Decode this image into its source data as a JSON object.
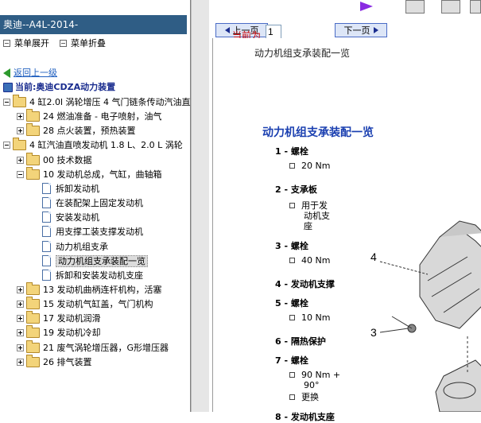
{
  "left": {
    "title": "奥迪--A4L-2014-",
    "menu_expand": "菜单展开",
    "menu_collapse": "菜单折叠",
    "back": "返回上一级",
    "current": "当前:奥迪CDZA动力装置",
    "tree": [
      {
        "label": "4 缸2.0l 涡轮增压 4 气门链条传动汽油直",
        "type": "folder",
        "expanded": true,
        "level": 0
      },
      {
        "label": "24 燃油准备 - 电子喷射，油气",
        "type": "folder",
        "expanded": false,
        "level": 1
      },
      {
        "label": "28 点火装置，预热装置",
        "type": "folder",
        "expanded": false,
        "level": 1
      },
      {
        "label": "4 缸汽油直喷发动机 1.8 L、2.0 L 涡轮",
        "type": "folder",
        "expanded": true,
        "level": 0
      },
      {
        "label": "00 技术数据",
        "type": "folder",
        "expanded": false,
        "level": 1
      },
      {
        "label": "10 发动机总成，气缸，曲轴箱",
        "type": "folder",
        "expanded": true,
        "level": 1
      },
      {
        "label": "拆卸发动机",
        "type": "doc",
        "level": 2
      },
      {
        "label": "在装配架上固定发动机",
        "type": "doc",
        "level": 2
      },
      {
        "label": "安装发动机",
        "type": "doc",
        "level": 2
      },
      {
        "label": "用支撑工装支撑发动机",
        "type": "doc",
        "level": 2
      },
      {
        "label": "动力机组支承",
        "type": "doc",
        "level": 2
      },
      {
        "label": "动力机组支承装配一览",
        "type": "doc",
        "level": 2,
        "selected": true
      },
      {
        "label": "拆卸和安装发动机支座",
        "type": "doc",
        "level": 2
      },
      {
        "label": "13 发动机曲柄连杆机构，活塞",
        "type": "folder",
        "expanded": false,
        "level": 1
      },
      {
        "label": "15 发动机气缸盖，气门机构",
        "type": "folder",
        "expanded": false,
        "level": 1
      },
      {
        "label": "17 发动机润滑",
        "type": "folder",
        "expanded": false,
        "level": 1
      },
      {
        "label": "19 发动机冷却",
        "type": "folder",
        "expanded": false,
        "level": 1
      },
      {
        "label": "21 废气涡轮增压器，G形增压器",
        "type": "folder",
        "expanded": false,
        "level": 1
      },
      {
        "label": "26 排气装置",
        "type": "folder",
        "expanded": false,
        "level": 1
      }
    ]
  },
  "nav": {
    "prev": "上一页",
    "next": "下一页",
    "current_label": "当前为",
    "current_value": "1"
  },
  "doc": {
    "header": "动力机组支承装配一览",
    "title": "动力机组支承装配一览",
    "items": [
      {
        "num": "1 - 螺栓",
        "sub": [
          "20 Nm"
        ]
      },
      {
        "num": "2 - 支承板",
        "sub": [
          "用于发",
          "动机支",
          "座"
        ]
      },
      {
        "num": "3 - 螺栓",
        "sub": [
          "40 Nm"
        ]
      },
      {
        "num": "4 - 发动机支撑",
        "sub": []
      },
      {
        "num": "5 - 螺栓",
        "sub": [
          "10 Nm"
        ]
      },
      {
        "num": "6 - 隔热保护",
        "sub": []
      },
      {
        "num": "7 - 螺栓",
        "sub": [
          "90 Nm +",
          "90°",
          "更换"
        ]
      },
      {
        "num": "8 - 发动机支座",
        "sub": []
      }
    ],
    "figure_labels": [
      "4",
      "3"
    ]
  },
  "colors": {
    "title_bar": "#2f5d85",
    "link": "#1f5fbf",
    "heading": "#1a3fb0",
    "page_label": "#cc0000"
  }
}
